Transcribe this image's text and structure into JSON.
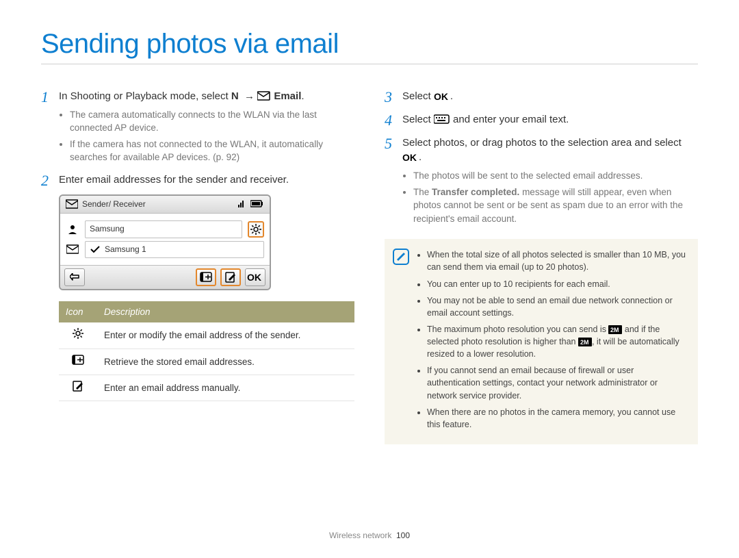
{
  "title": "Sending photos via email",
  "footer": {
    "section": "Wireless network",
    "page": "100"
  },
  "left": {
    "step1": {
      "pre": "In Shooting or Playback mode, select ",
      "mode_key": "N",
      "arrow": "→",
      "email_label": "Email",
      "period": ".",
      "sub": [
        "The camera automatically connects to the WLAN via the last connected AP device.",
        "If the camera has not connected to the WLAN, it automatically searches for available AP devices. (p. 92)"
      ]
    },
    "step2": {
      "text": "Enter email addresses for the sender and receiver."
    },
    "cam": {
      "header": "Sender/ Receiver",
      "sender_field": "Samsung",
      "receiver_field": "Samsung 1"
    },
    "table": {
      "h_icon": "Icon",
      "h_desc": "Description",
      "rows": [
        {
          "icon": "gear",
          "desc": "Enter or modify the email address of the sender."
        },
        {
          "icon": "addressbook",
          "desc": "Retrieve the stored email addresses."
        },
        {
          "icon": "compose",
          "desc": "Enter an email address manually."
        }
      ]
    }
  },
  "right": {
    "step3": {
      "pre": "Select ",
      "glyph": "OK",
      "post": "."
    },
    "step4": {
      "pre": "Select ",
      "glyph": "keyboard",
      "post": " and enter your email text."
    },
    "step5": {
      "pre": "Select photos, or drag photos to the selection area and select ",
      "glyph": "OK",
      "post": ".",
      "sub_a": "The photos will be sent to the selected email addresses.",
      "sub_b_pre": "The ",
      "sub_b_bold": "Transfer completed.",
      "sub_b_post": " message will still appear, even when photos cannot be sent or be sent as spam due to an error with the recipient's email account."
    },
    "notes": [
      "When the total size of all photos selected is smaller than 10 MB, you can send them via email (up to 20 photos).",
      "You can enter up to 10 recipients for each email.",
      "You may not be able to send an email due network connection or email account settings.",
      {
        "pre": "The maximum photo resolution you can send is ",
        "mid": " and if the selected photo resolution is higher than ",
        "post": ", it will be automatically resized to a lower resolution."
      },
      "If you cannot send an email because of firewall or user authentication settings, contact your network administrator or network service provider.",
      "When there are no photos in the camera memory, you cannot use this feature."
    ]
  }
}
